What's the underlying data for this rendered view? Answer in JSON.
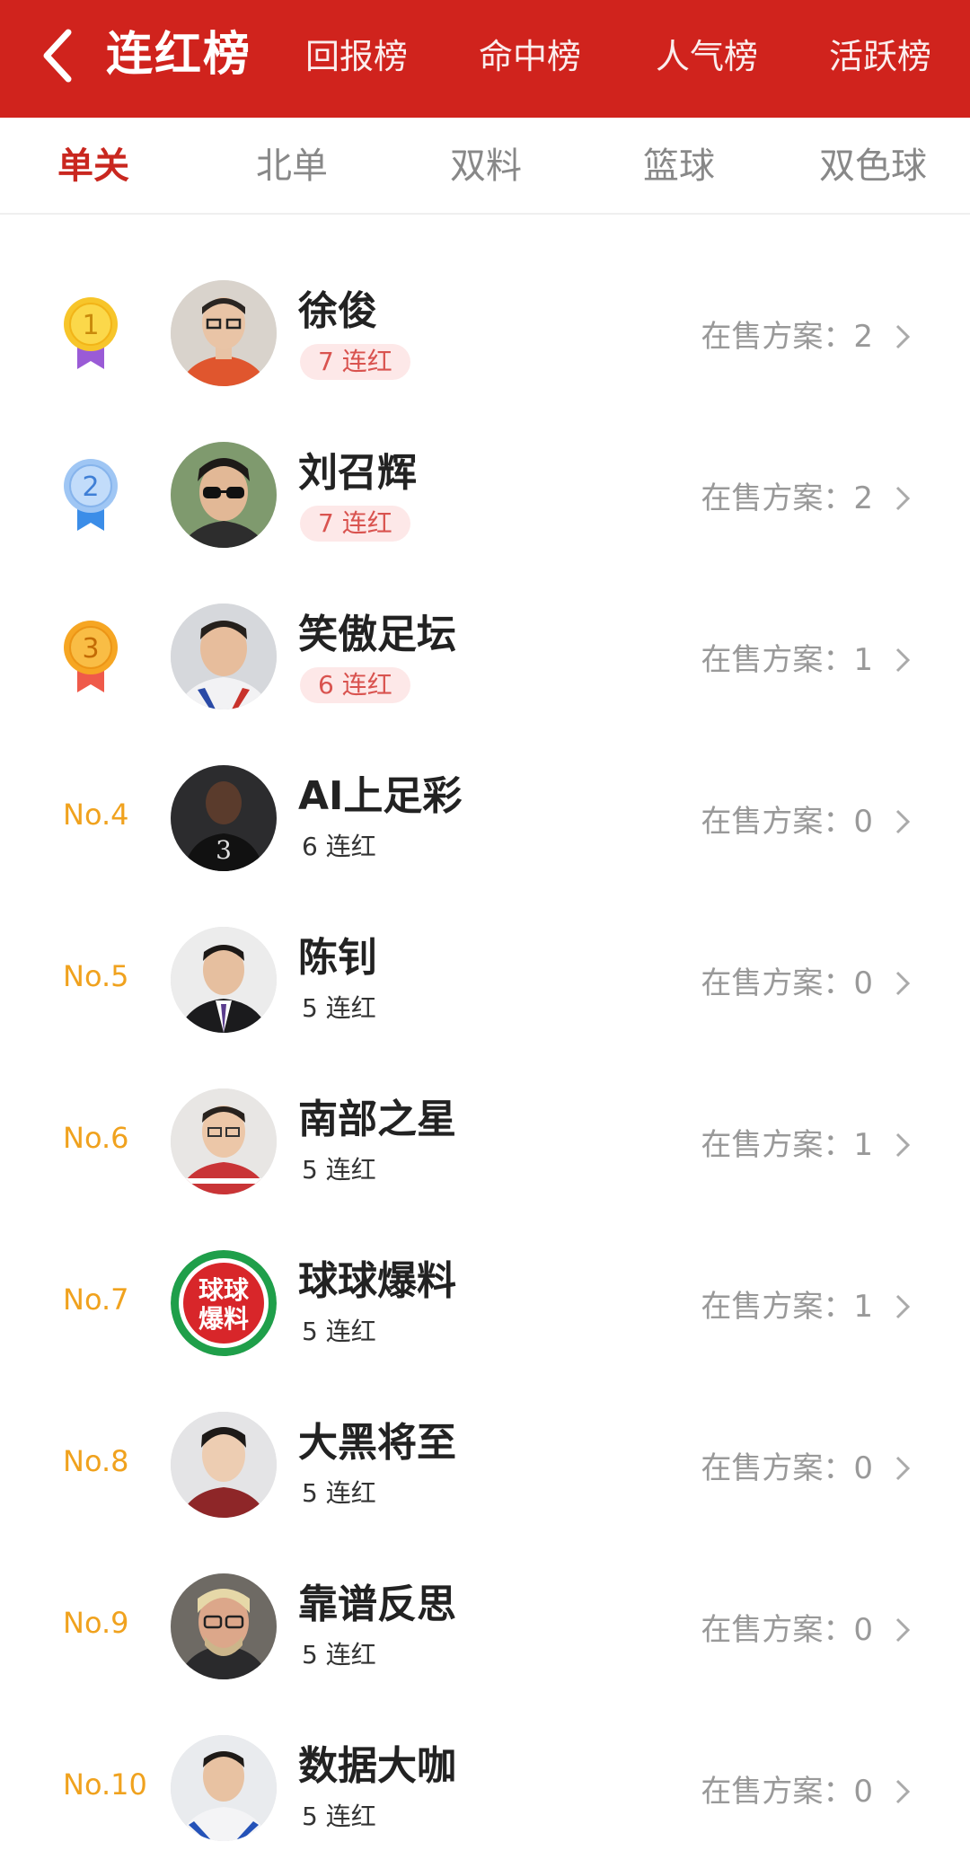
{
  "header": {
    "title": "连红榜",
    "tabs": [
      "回报榜",
      "命中榜",
      "人气榜",
      "活跃榜"
    ]
  },
  "subtabs": {
    "items": [
      "单关",
      "北单",
      "双料",
      "篮球",
      "双色球"
    ],
    "active_index": 0
  },
  "list": {
    "onsale_label": "在售方案：",
    "items": [
      {
        "rank": "1",
        "name": "徐俊",
        "streak": "7 连红",
        "onsale": "2"
      },
      {
        "rank": "2",
        "name": "刘召辉",
        "streak": "7 连红",
        "onsale": "2"
      },
      {
        "rank": "3",
        "name": "笑傲足坛",
        "streak": "6 连红",
        "onsale": "1"
      },
      {
        "rank": "No.4",
        "name": "AI上足彩",
        "streak": "6 连红",
        "onsale": "0"
      },
      {
        "rank": "No.5",
        "name": "陈钊",
        "streak": "5 连红",
        "onsale": "0"
      },
      {
        "rank": "No.6",
        "name": "南部之星",
        "streak": "5 连红",
        "onsale": "1"
      },
      {
        "rank": "No.7",
        "name": "球球爆料",
        "streak": "5 连红",
        "onsale": "1"
      },
      {
        "rank": "No.8",
        "name": "大黑将至",
        "streak": "5 连红",
        "onsale": "0"
      },
      {
        "rank": "No.9",
        "name": "靠谱反思",
        "streak": "5 连红",
        "onsale": "0"
      },
      {
        "rank": "No.10",
        "name": "数据大咖",
        "streak": "5 连红",
        "onsale": "0"
      }
    ],
    "logo_text": "球球爆料",
    "medal_colors": [
      "#f7c52a",
      "#9fc6f4",
      "#f6a623"
    ],
    "ribbon_colors": [
      "#9a5bd6",
      "#3b8de8",
      "#ef5a4a"
    ],
    "rank_color": "#f0a21e"
  },
  "colors": {
    "brand_red": "#d0231d",
    "active_tab": "#c9271f",
    "streak_pill_bg": "#fde8e8",
    "streak_pill_text": "#d9534f"
  },
  "icons": {
    "back": "chevron-left-icon",
    "row_arrow": "chevron-right-icon"
  }
}
